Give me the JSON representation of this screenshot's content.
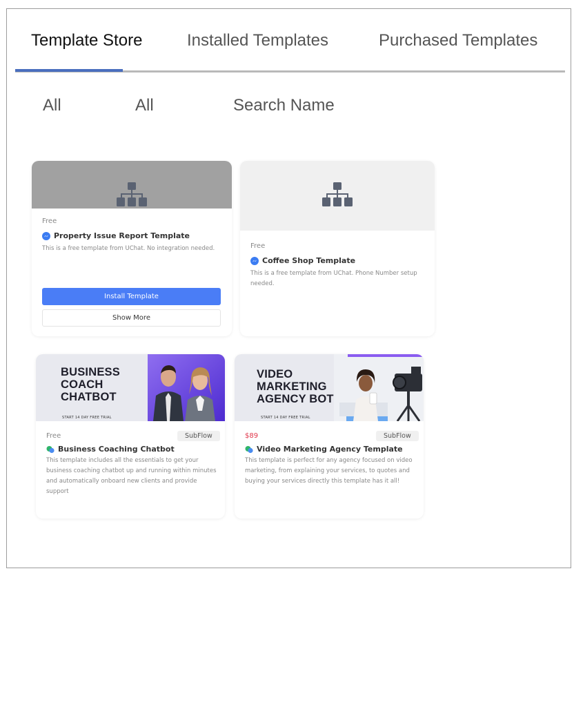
{
  "tabs": [
    {
      "label": "Template Store",
      "active": true
    },
    {
      "label": "Installed Templates",
      "active": false
    },
    {
      "label": "Purchased Templates",
      "active": false
    }
  ],
  "filters": {
    "category": "All",
    "channel": "All",
    "search_placeholder": "Search Name"
  },
  "cards": [
    {
      "price": "Free",
      "title": "Property Issue Report Template",
      "description": "This is a free template from UChat. No integration needed.",
      "channel_icon": "messenger-icon",
      "preview_icon": "sitemap-icon",
      "install_label": "Install Template",
      "more_label": "Show More"
    },
    {
      "price": "Free",
      "title": "Coffee Shop Template",
      "description": "This is a free template from UChat. Phone Number setup needed.",
      "channel_icon": "messenger-icon",
      "preview_icon": "sitemap-icon"
    },
    {
      "price": "Free",
      "badge": "SubFlow",
      "title": "Business Coaching Chatbot",
      "description": "This template includes all the essentials to get your business coaching chatbot up and running within minutes and automatically onboard new clients and provide support",
      "channel_icon": "chat-bubbles-icon",
      "banner_headline": "BUSINESS\nCOACH\nCHATBOT",
      "banner_trial": "START 14 DAY FREE TRIAL"
    },
    {
      "price": "$89",
      "badge": "SubFlow",
      "title": "Video Marketing Agency Template",
      "description": "This template is perfect for any agency focused on video marketing, from explaining your services, to quotes and buying your services directly this template has it all!",
      "channel_icon": "chat-bubbles-icon",
      "banner_headline": "VIDEO\nMARKETING\nAGENCY BOT",
      "banner_trial": "START 14 DAY FREE TRIAL"
    }
  ],
  "colors": {
    "accent": "#4a7df6",
    "tab_indicator": "#4a6fbf",
    "paid_price": "#e0364b"
  }
}
